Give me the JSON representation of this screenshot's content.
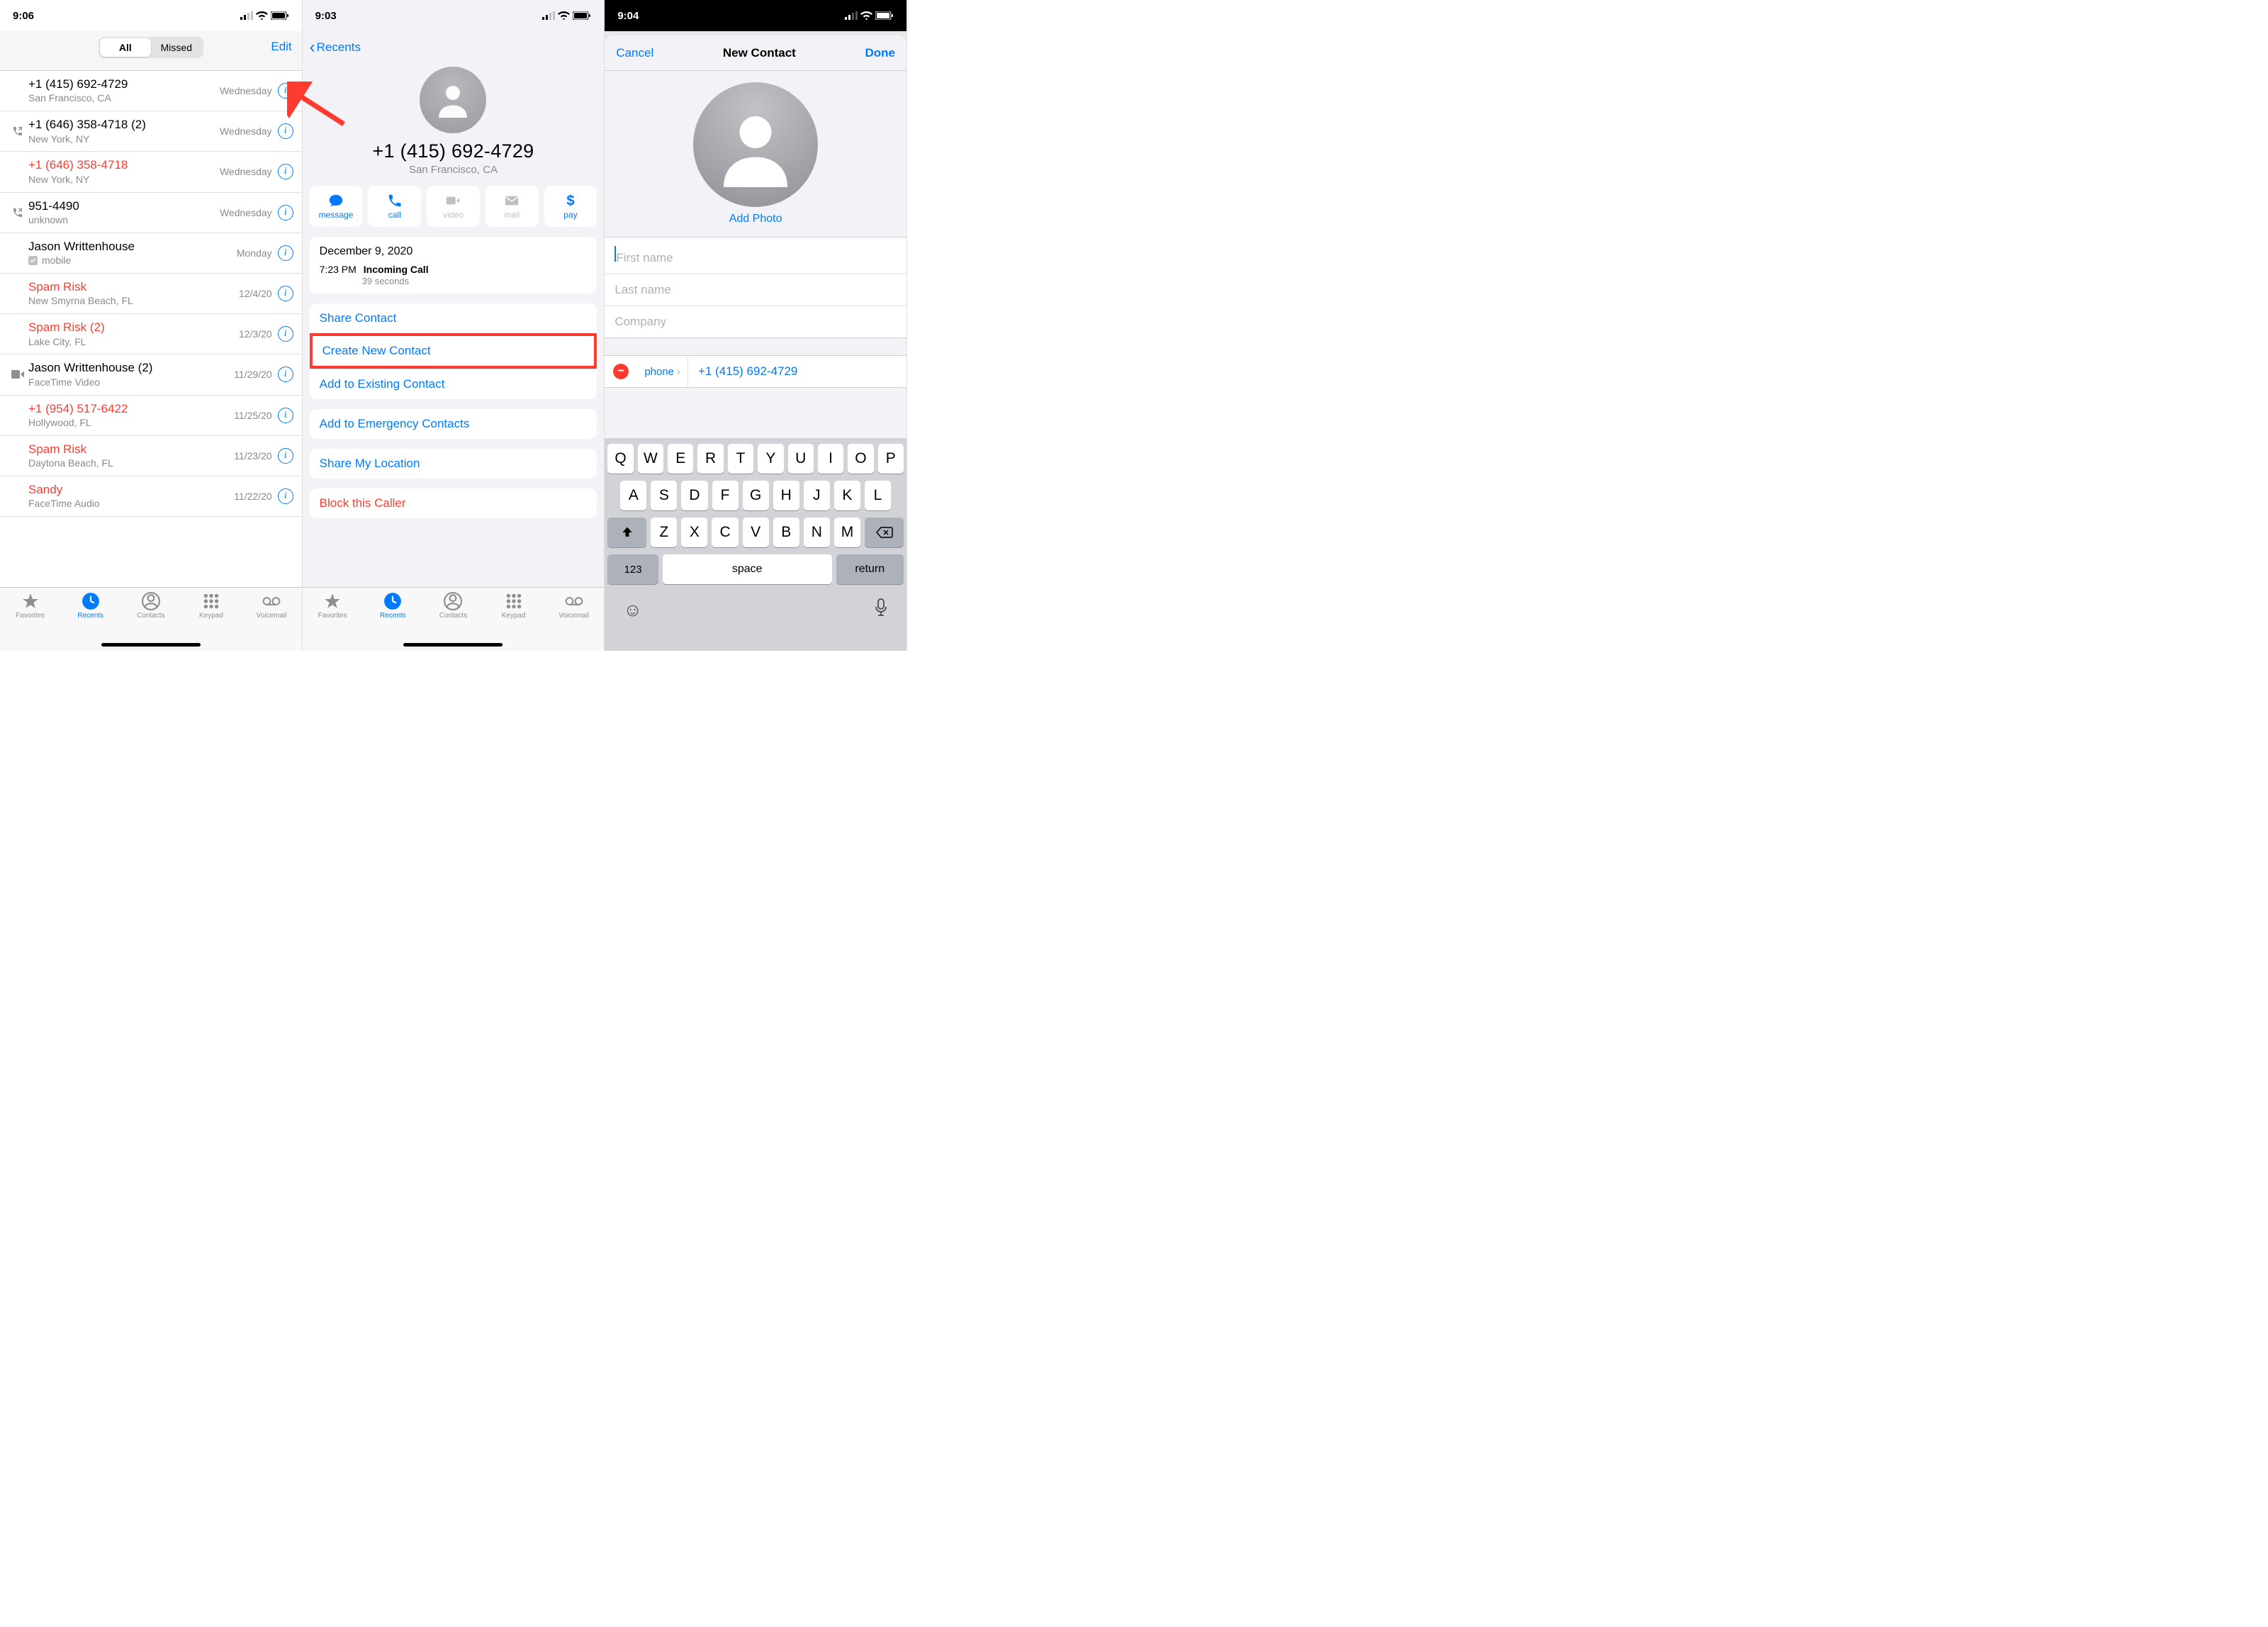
{
  "screen1": {
    "time": "9:06",
    "seg_all": "All",
    "seg_missed": "Missed",
    "edit": "Edit",
    "calls": [
      {
        "title": "+1 (415) 692-4729",
        "sub": "San Francisco, CA",
        "time": "Wednesday",
        "missed": false,
        "icon": ""
      },
      {
        "title": "+1 (646) 358-4718 (2)",
        "sub": "New York, NY",
        "time": "Wednesday",
        "missed": false,
        "icon": "outgoing"
      },
      {
        "title": "+1 (646) 358-4718",
        "sub": "New York, NY",
        "time": "Wednesday",
        "missed": true,
        "icon": ""
      },
      {
        "title": "951-4490",
        "sub": "unknown",
        "time": "Wednesday",
        "missed": false,
        "icon": "outgoing"
      },
      {
        "title": "Jason Writtenhouse",
        "sub": "mobile",
        "time": "Monday",
        "missed": false,
        "icon": "",
        "check": true
      },
      {
        "title": "Spam Risk",
        "sub": "New Smyrna Beach, FL",
        "time": "12/4/20",
        "missed": true,
        "icon": ""
      },
      {
        "title": "Spam Risk (2)",
        "sub": "Lake City, FL",
        "time": "12/3/20",
        "missed": true,
        "icon": ""
      },
      {
        "title": "Jason Writtenhouse (2)",
        "sub": "FaceTime Video",
        "time": "11/29/20",
        "missed": false,
        "icon": "video"
      },
      {
        "title": "+1 (954) 517-6422",
        "sub": "Hollywood, FL",
        "time": "11/25/20",
        "missed": true,
        "icon": ""
      },
      {
        "title": "Spam Risk",
        "sub": "Daytona Beach, FL",
        "time": "11/23/20",
        "missed": true,
        "icon": ""
      },
      {
        "title": "Sandy",
        "sub": "FaceTime Audio",
        "time": "11/22/20",
        "missed": true,
        "icon": ""
      }
    ],
    "tabs": {
      "fav": "Favorites",
      "rec": "Recents",
      "con": "Contacts",
      "key": "Keypad",
      "vm": "Voicemail"
    }
  },
  "screen2": {
    "time": "9:03",
    "back": "Recents",
    "number": "+1 (415) 692-4729",
    "location": "San Francisco, CA",
    "actions": {
      "msg": "message",
      "call": "call",
      "vid": "video",
      "mail": "mail",
      "pay": "pay"
    },
    "call_date": "December 9, 2020",
    "call_time": "7:23 PM",
    "call_type": "Incoming Call",
    "call_dur": "39 seconds",
    "share": "Share Contact",
    "create": "Create New Contact",
    "addto": "Add to Existing Contact",
    "emerg": "Add to Emergency Contacts",
    "shareloc": "Share My Location",
    "block": "Block this Caller"
  },
  "screen3": {
    "time": "9:04",
    "cancel": "Cancel",
    "title": "New Contact",
    "done": "Done",
    "add_photo": "Add Photo",
    "ph_first": "First name",
    "ph_last": "Last name",
    "ph_company": "Company",
    "phone_label": "phone",
    "phone_value": "+1 (415) 692-4729",
    "kb_123": "123",
    "kb_space": "space",
    "kb_return": "return",
    "row1": [
      "Q",
      "W",
      "E",
      "R",
      "T",
      "Y",
      "U",
      "I",
      "O",
      "P"
    ],
    "row2": [
      "A",
      "S",
      "D",
      "F",
      "G",
      "H",
      "J",
      "K",
      "L"
    ],
    "row3": [
      "Z",
      "X",
      "C",
      "V",
      "B",
      "N",
      "M"
    ]
  }
}
